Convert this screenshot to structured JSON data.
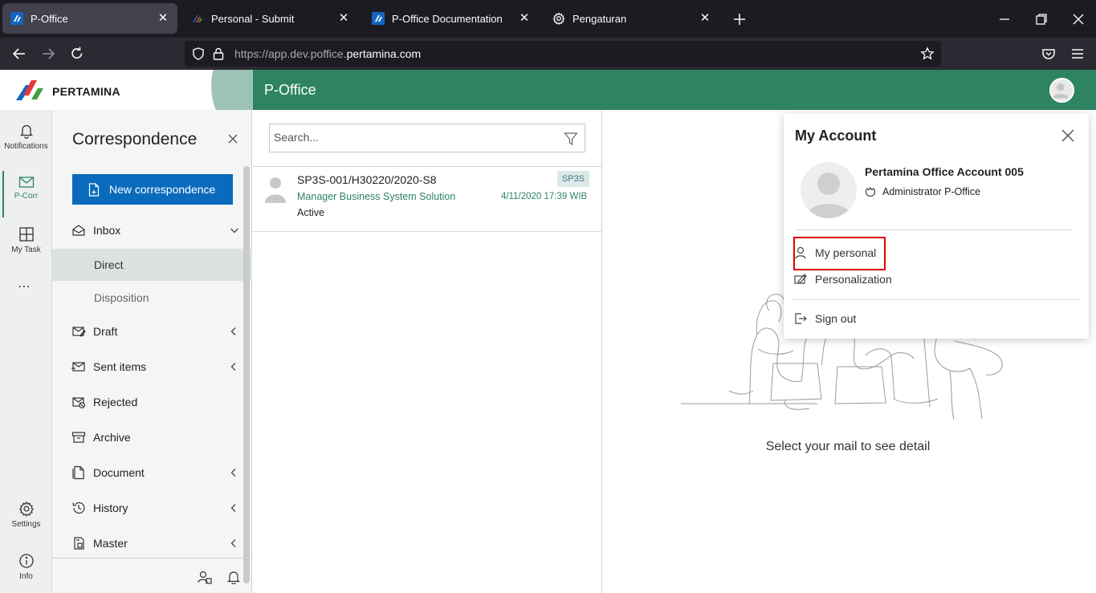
{
  "browser": {
    "tabs": [
      {
        "title": "P-Office",
        "icon": "p-office-favicon",
        "active": true
      },
      {
        "title": "Personal - Submit",
        "icon": "pertamina-favicon",
        "active": false
      },
      {
        "title": "P-Office Documentation",
        "icon": "p-office-favicon",
        "active": false
      },
      {
        "title": "Pengaturan",
        "icon": "gear-icon",
        "active": false
      }
    ],
    "url_prefix": "https://app.dev.poffice.",
    "url_domain": "pertamina.com"
  },
  "header": {
    "logo_text": "PERTAMINA",
    "app_title": "P-Office",
    "brand_color": "#2e8462"
  },
  "rail": {
    "items": [
      {
        "label": "Notifications",
        "icon": "bell-icon"
      },
      {
        "label": "P-Corr",
        "icon": "mail-icon",
        "active": true
      },
      {
        "label": "My Task",
        "icon": "grid-icon"
      },
      {
        "label": "Settings",
        "icon": "gear-icon"
      },
      {
        "label": "Info",
        "icon": "info-icon"
      }
    ],
    "more": "⋯"
  },
  "menu": {
    "title": "Correspondence",
    "new_button": "New correspondence",
    "items": [
      {
        "label": "Inbox",
        "icon": "inbox-icon",
        "expanded": true
      },
      {
        "label": "Direct",
        "sub": true,
        "selected": true
      },
      {
        "label": "Disposition",
        "sub": true
      },
      {
        "label": "Draft",
        "icon": "draft-icon"
      },
      {
        "label": "Sent items",
        "icon": "sent-icon"
      },
      {
        "label": "Rejected",
        "icon": "rejected-icon"
      },
      {
        "label": "Archive",
        "icon": "archive-icon"
      },
      {
        "label": "Document",
        "icon": "document-icon"
      },
      {
        "label": "History",
        "icon": "history-icon"
      },
      {
        "label": "Master",
        "icon": "master-icon"
      }
    ]
  },
  "list": {
    "search_placeholder": "Search...",
    "mails": [
      {
        "subject": "SP3S-001/H30220/2020-S8",
        "sender": "Manager Business System Solution",
        "status": "Active",
        "tag": "SP3S",
        "date": "4/11/2020 17:39 WIB"
      }
    ]
  },
  "detail": {
    "empty_message": "Select your mail to see detail"
  },
  "account": {
    "title": "My Account",
    "name": "Pertamina Office Account 005",
    "role": "Administrator P-Office",
    "items": [
      {
        "label": "My personal",
        "icon": "person-icon",
        "highlighted": true
      },
      {
        "label": "Personalization",
        "icon": "personalization-icon"
      },
      {
        "label": "Sign out",
        "icon": "sign-out-icon"
      }
    ],
    "highlight_color": "#e00000"
  }
}
